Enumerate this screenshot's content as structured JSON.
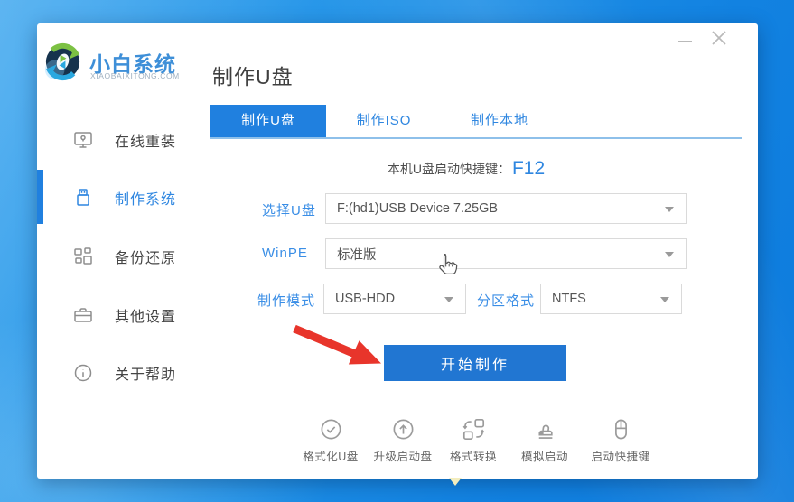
{
  "window": {
    "title": "制作U盘",
    "brand": {
      "name": "小白系统",
      "domain": "XIAOBAIXITONG.COM"
    }
  },
  "sidebar": {
    "items": [
      {
        "label": "在线重装",
        "icon": "monitor-reinstall-icon",
        "active": false
      },
      {
        "label": "制作系统",
        "icon": "usb-drive-icon",
        "active": true
      },
      {
        "label": "备份还原",
        "icon": "backup-restore-icon",
        "active": false
      },
      {
        "label": "其他设置",
        "icon": "toolbox-icon",
        "active": false
      },
      {
        "label": "关于帮助",
        "icon": "info-icon",
        "active": false
      }
    ]
  },
  "tabs": [
    {
      "label": "制作U盘",
      "active": true
    },
    {
      "label": "制作ISO",
      "active": false
    },
    {
      "label": "制作本地",
      "active": false
    }
  ],
  "hotkey": {
    "label": "本机U盘启动快捷键：",
    "value": "F12"
  },
  "form": {
    "usb_label": "选择U盘",
    "usb_value": "F:(hd1)USB Device 7.25GB",
    "winpe_label": "WinPE",
    "winpe_value": "标准版",
    "mode_label": "制作模式",
    "mode_value": "USB-HDD",
    "partition_label": "分区格式",
    "partition_value": "NTFS"
  },
  "primary_button": {
    "label": "开始制作"
  },
  "quick_actions": [
    {
      "label": "格式化U盘",
      "icon": "check-circle-icon"
    },
    {
      "label": "升级启动盘",
      "icon": "upgrade-arrow-icon"
    },
    {
      "label": "格式转换",
      "icon": "format-convert-icon"
    },
    {
      "label": "模拟启动",
      "icon": "stamp-icon"
    },
    {
      "label": "启动快捷键",
      "icon": "mouse-icon"
    }
  ],
  "colors": {
    "accent": "#2080df",
    "label_blue": "#3a8ee6",
    "button_blue": "#2176d2",
    "arrow_red": "#e8352b",
    "background_blue": "#1282e1"
  }
}
